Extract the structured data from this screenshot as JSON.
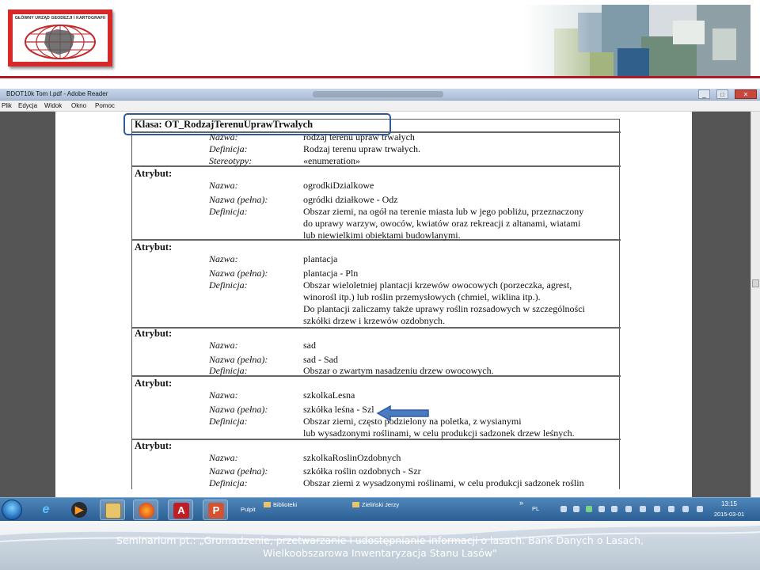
{
  "slide": {
    "logo_title": "GŁÓWNY URZĄD GEODEZJI I KARTOGRAFII",
    "footer_line1": "Seminarium pt.: „Gromadzenie, przetwarzanie i udostępnianie informacji o lasach. Bank Danych o Lasach,",
    "footer_line2": "Wielkoobszarowa Inwentaryzacja Stanu Lasów\"",
    "accent_color": "#b21a2a"
  },
  "window": {
    "title": "BDOT10k Tom I.pdf - Adobe Reader",
    "menu": [
      "Plik",
      "Edycja",
      "Widok",
      "Okno",
      "Pomoc"
    ],
    "controls": {
      "minimize": "_",
      "maximize": "□",
      "close": "✕"
    }
  },
  "document": {
    "class_header": "Klasa: OT_RodzajTerenuUprawTrwalych",
    "class_info": [
      {
        "label": "Nazwa:",
        "value": "rodzaj terenu upraw trwałych"
      },
      {
        "label": "Definicja:",
        "value": "Rodzaj terenu upraw trwałych."
      },
      {
        "label": "Stereotypy:",
        "value": "«enumeration»"
      }
    ],
    "attribute_label": "Atrybut:",
    "attributes": [
      {
        "name_label": "Nazwa:",
        "name": "ogrodkiDzialkowe",
        "full_label": "Nazwa (pełna):",
        "full": "ogródki działkowe - Odz",
        "def_label": "Definicja:",
        "def_lines": [
          "Obszar ziemi, na ogół na terenie miasta lub w jego pobliżu, przeznaczony",
          "do uprawy warzyw, owoców, kwiatów oraz rekreacji z altanami, wiatami",
          "lub niewielkimi obiektami budowlanymi."
        ]
      },
      {
        "name_label": "Nazwa:",
        "name": "plantacja",
        "full_label": "Nazwa (pełna):",
        "full": "plantacja - Pln",
        "def_label": "Definicja:",
        "def_lines": [
          "Obszar wieloletniej plantacji krzewów owocowych (porzeczka, agrest,",
          "winorośl itp.) lub roślin przemysłowych (chmiel, wiklina itp.).",
          "Do plantacji zaliczamy także uprawy roślin rozsadowych w szczególności",
          "szkółki drzew i krzewów ozdobnych."
        ]
      },
      {
        "name_label": "Nazwa:",
        "name": "sad",
        "full_label": "Nazwa (pełna):",
        "full": "sad - Sad",
        "def_label": "Definicja:",
        "def_lines": [
          "Obszar o zwartym nasadzeniu drzew owocowych."
        ]
      },
      {
        "name_label": "Nazwa:",
        "name": "szkolkaLesna",
        "full_label": "Nazwa (pełna):",
        "full": "szkółka leśna - Szl",
        "def_label": "Definicja:",
        "def_lines": [
          "Obszar ziemi, często podzielony na poletka, z wysianymi",
          "lub wysadzonymi roślinami, w celu produkcji sadzonek drzew leśnych."
        ]
      },
      {
        "name_label": "Nazwa:",
        "name": "szkolkaRoslinOzdobnych",
        "full_label": "Nazwa (pełna):",
        "full": "szkółka roślin ozdobnych - Szr",
        "def_label": "Definicja:",
        "def_lines": [
          "Obszar ziemi z wysadzonymi roślinami, w celu produkcji sadzonek roślin"
        ]
      }
    ]
  },
  "taskbar": {
    "items": [
      {
        "icon": "ie-icon"
      },
      {
        "icon": "media-player-icon"
      },
      {
        "icon": "file-explorer-icon"
      },
      {
        "icon": "firefox-icon"
      },
      {
        "icon": "adobe-reader-icon"
      },
      {
        "icon": "powerpoint-icon"
      }
    ],
    "pulpit_label": "Pulpit",
    "libraries_label": "Biblioteki",
    "user_folder_label": "Zieliński Jerzy",
    "language": "PL",
    "time": "13:15",
    "date": "2015-03-01",
    "expand_glyph": "»"
  }
}
